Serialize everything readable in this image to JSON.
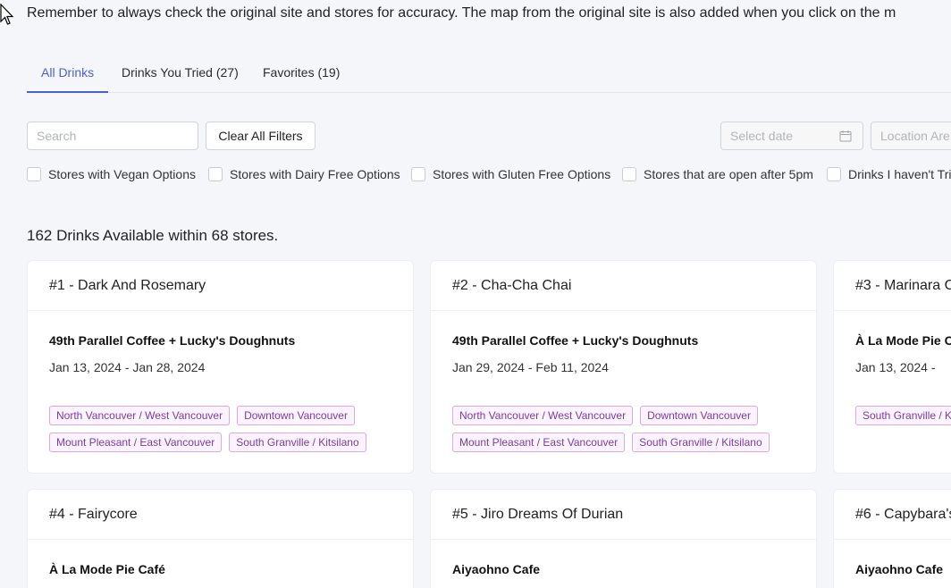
{
  "notice": "Remember to always check the original site and stores for accuracy. The map from the original site is also added when you click on the m",
  "tabs": [
    {
      "label": "All Drinks",
      "active": true
    },
    {
      "label": "Drinks You Tried (27)",
      "active": false
    },
    {
      "label": "Favorites (19)",
      "active": false
    }
  ],
  "search": {
    "placeholder": "Search"
  },
  "clear_filters_label": "Clear All Filters",
  "date_placeholder": "Select date",
  "location_placeholder": "Location Are",
  "filters": [
    "Stores with Vegan Options",
    "Stores with Dairy Free Options",
    "Stores with Gluten Free Options",
    "Stores that are open after 5pm",
    "Drinks I haven't Tri"
  ],
  "summary": "162 Drinks Available within 68 stores.",
  "cards": [
    {
      "title": "#1 - Dark And Rosemary",
      "store": "49th Parallel Coffee + Lucky's Doughnuts",
      "dates": "Jan 13, 2024 - Jan 28, 2024",
      "tags": [
        "North Vancouver / West Vancouver",
        "Downtown Vancouver",
        "Mount Pleasant / East Vancouver",
        "South Granville / Kitsilano"
      ]
    },
    {
      "title": "#2 - Cha-Cha Chai",
      "store": "49th Parallel Coffee + Lucky's Doughnuts",
      "dates": "Jan 29, 2024 - Feb 11, 2024",
      "tags": [
        "North Vancouver / West Vancouver",
        "Downtown Vancouver",
        "Mount Pleasant / East Vancouver",
        "South Granville / Kitsilano"
      ]
    },
    {
      "title": "#3 - Marinara C",
      "store": "À La Mode Pie C",
      "dates": "Jan 13, 2024 -",
      "tags": [
        "South Granville / K"
      ]
    },
    {
      "title": "#4 - Fairycore",
      "store": "À La Mode Pie Café"
    },
    {
      "title": "#5 - Jiro Dreams Of Durian",
      "store": "Aiyaohno Cafe"
    },
    {
      "title": "#6 - Capybara's",
      "store": "Aiyaohno Cafe"
    }
  ],
  "colors": {
    "accent": "#4a5fd8",
    "tag_text": "#7d3aa8",
    "tag_border": "#d7a9e8",
    "background": "#f5f6fa"
  }
}
